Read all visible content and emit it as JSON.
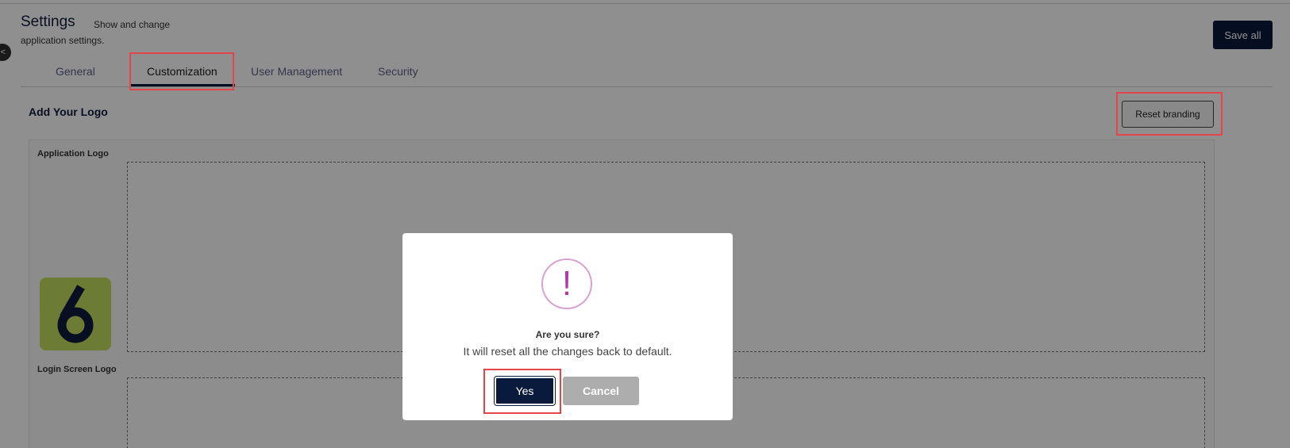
{
  "header": {
    "title": "Settings",
    "subtitle_line1": "Show and change",
    "subtitle_line2": "application settings.",
    "save_all_label": "Save all",
    "collapse_icon_glyph": "<"
  },
  "tabs": [
    {
      "label": "General",
      "active": false
    },
    {
      "label": "Customization",
      "active": true
    },
    {
      "label": "User Management",
      "active": false
    },
    {
      "label": "Security",
      "active": false
    }
  ],
  "branding": {
    "section_title": "Add Your Logo",
    "reset_label": "Reset branding",
    "application_logo_label": "Application Logo",
    "login_logo_label": "Login Screen Logo",
    "logo_glyph_icon": "six-logo-icon"
  },
  "dialog": {
    "icon_glyph": "!",
    "title": "Are you sure?",
    "message": "It will reset all the changes back to default.",
    "confirm_label": "Yes",
    "cancel_label": "Cancel"
  },
  "colors": {
    "primary": "#0a1a3c",
    "warning_accent": "#b13ba4",
    "highlight": "#e4444a",
    "logo_green": "#c2de5e"
  }
}
